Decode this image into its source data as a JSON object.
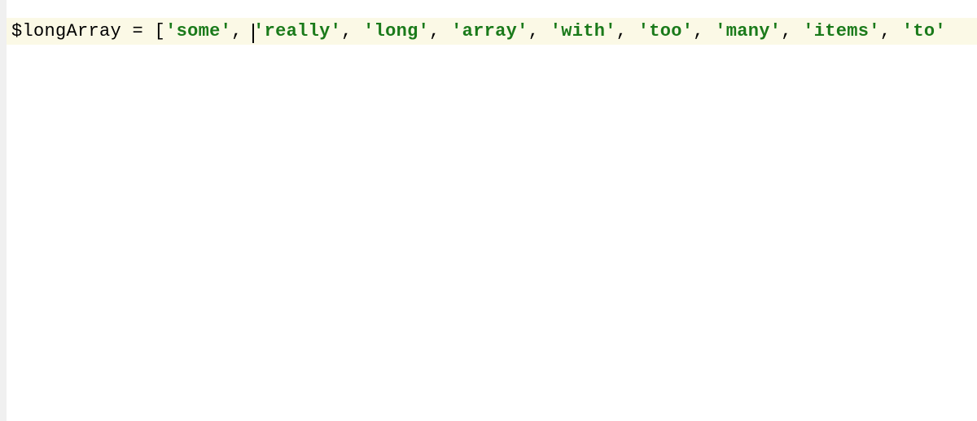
{
  "code": {
    "variable": "$longArray",
    "operator": " = ",
    "bracket": "[",
    "strings": [
      "'some'",
      "'really'",
      "'long'",
      "'array'",
      "'with'",
      "'too'",
      "'many'",
      "'items'",
      "'to'"
    ],
    "separator": ", ",
    "cursor_position": 1
  },
  "colors": {
    "highlight_bg": "#fbf9e6",
    "string_color": "#1a7a1a",
    "text_color": "#000000",
    "gutter_bg": "#f0f0f0"
  }
}
